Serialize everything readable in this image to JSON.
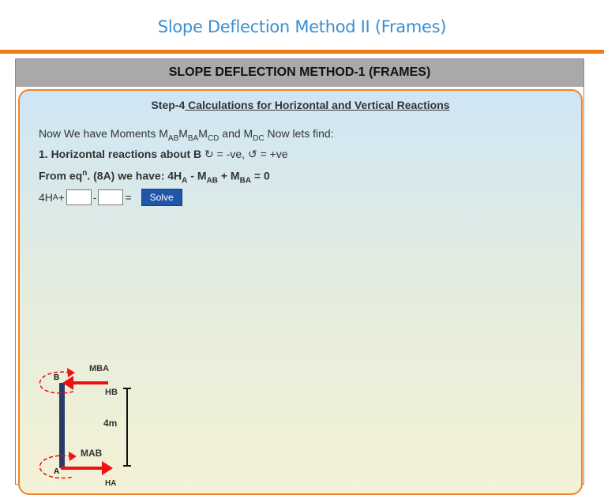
{
  "page": {
    "title": "Slope Deflection Method II (Frames)"
  },
  "panel": {
    "header": "SLOPE DEFLECTION METHOD-1 (FRAMES)"
  },
  "step": {
    "prefix": "Step-4",
    "title": " Calculations for Horizontal and Vertical Reactions"
  },
  "intro": {
    "text1": "Now We have Moments M",
    "s1": "AB",
    "t2": "M",
    "s2": "BA",
    "t3": "M",
    "s3": "CD",
    "t4": " and M",
    "s4": "DC",
    "t5": " Now lets find:"
  },
  "heading1": {
    "bold": "1. Horizontal reactions about B",
    "sign": " ↻ = -ve, ↺ = +ve"
  },
  "equation": {
    "a": "From eq",
    "sup": "n",
    "b": ". (8A) we have: 4H",
    "s1": "A",
    "c": " - M",
    "s2": "AB",
    "d": " + M",
    "s3": "BA",
    "e": " = 0"
  },
  "input_row": {
    "lhs": "4H",
    "lhs_sub": "A",
    "plus": " +",
    "minus": "-",
    "equals": "=",
    "solve_label": "Solve"
  },
  "diagram": {
    "m_ba": "MBA",
    "h_b": "HB",
    "length": "4m",
    "m_ab": "MAB",
    "h_a": "HA",
    "node_b": "B",
    "node_a": "A",
    "colors": {
      "member": "#2a3c66",
      "arrow": "#ee1111"
    }
  }
}
